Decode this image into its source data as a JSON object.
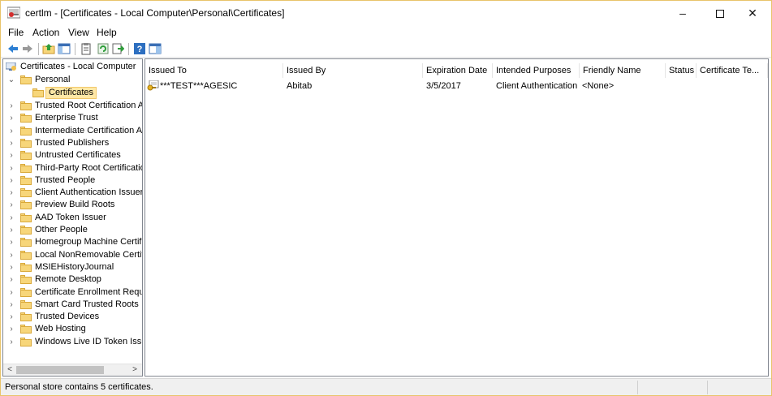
{
  "window": {
    "title": "certlm - [Certificates - Local Computer\\Personal\\Certificates]",
    "controls": {
      "minimize": "–",
      "maximize": "",
      "close": "✕"
    }
  },
  "menu": {
    "file": "File",
    "action": "Action",
    "view": "View",
    "help": "Help"
  },
  "toolbar": {
    "icons": [
      "back-icon",
      "forward-icon",
      "up-folder-icon",
      "show-hide-tree-icon",
      "properties-icon",
      "refresh-icon",
      "export-list-icon",
      "help-icon",
      "show-action-pane-icon"
    ]
  },
  "tree": {
    "root": "Certificates - Local Computer",
    "personal": "Personal",
    "certificates": "Certificates",
    "items": [
      "Trusted Root Certification Au",
      "Enterprise Trust",
      "Intermediate Certification Au",
      "Trusted Publishers",
      "Untrusted Certificates",
      "Third-Party Root Certificatior",
      "Trusted People",
      "Client Authentication Issuers",
      "Preview Build Roots",
      "AAD Token Issuer",
      "Other People",
      "Homegroup Machine Certific",
      "Local NonRemovable Certific",
      "MSIEHistoryJournal",
      "Remote Desktop",
      "Certificate Enrollment Reque:",
      "Smart Card Trusted Roots",
      "Trusted Devices",
      "Web Hosting",
      "Windows Live ID Token Issuer"
    ],
    "scroll_left": "<",
    "scroll_right": ">"
  },
  "list": {
    "columns": [
      "Issued To",
      "Issued By",
      "Expiration Date",
      "Intended Purposes",
      "Friendly Name",
      "Status",
      "Certificate Te..."
    ],
    "sort_indicator": "^",
    "rows": [
      {
        "issued_to": "***TEST***AGESIC",
        "issued_by": "Abitab",
        "expiration": "3/5/2017",
        "purposes": "Client Authentication",
        "friendly_name": "<None>",
        "status": "",
        "template": ""
      }
    ]
  },
  "status": {
    "text": "Personal store contains 5 certificates."
  },
  "colors": {
    "selection": "#ffe8a6",
    "folder": "#f7d67a",
    "border": "#e8c46a"
  }
}
